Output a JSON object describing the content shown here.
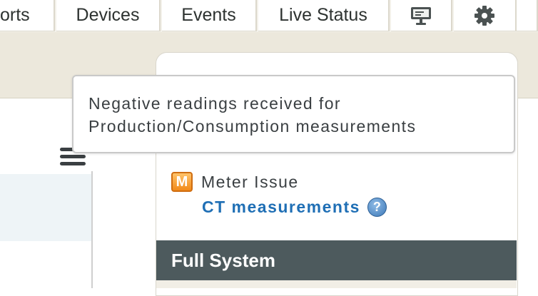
{
  "nav": {
    "tabs": [
      {
        "label": "orts"
      },
      {
        "label": "Devices"
      },
      {
        "label": "Events"
      },
      {
        "label": "Live Status"
      }
    ],
    "icons": [
      "monitor-icon",
      "gear-icon"
    ]
  },
  "tooltip": {
    "line1": "Negative readings received for",
    "line2": "Production/Consumption measurements"
  },
  "status": {
    "badge": "M",
    "title": "Meter Issue",
    "link": "CT measurements",
    "help": "?"
  },
  "section": {
    "title": "Full System"
  },
  "colors": {
    "section_bg": "#4d5a5d",
    "link": "#1f6fb5",
    "badge": "#f28a1a",
    "band": "#ece8dc"
  }
}
